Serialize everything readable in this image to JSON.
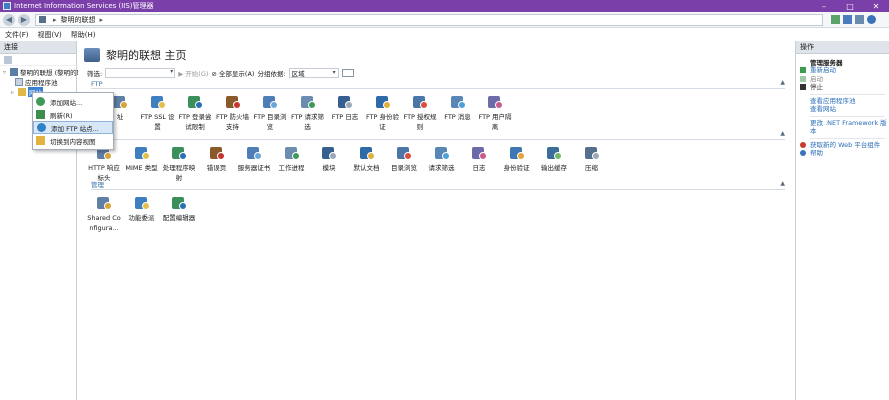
{
  "window": {
    "title": "Internet Information Services (IIS)管理器",
    "controls": {
      "minimize": "–",
      "maximize": "□",
      "close": "✕"
    }
  },
  "address": {
    "crumbs": [
      "黎明的联想"
    ],
    "separator": "▸"
  },
  "menu": [
    "文件(F)",
    "视图(V)",
    "帮助(H)"
  ],
  "connections": {
    "header": "连接",
    "tree": [
      {
        "label": "黎明的联想 (黎明的联",
        "twisty": "▿"
      },
      {
        "label": "应用程序池",
        "twisty": ""
      },
      {
        "label": "网站",
        "twisty": "▹"
      }
    ]
  },
  "context_menu": {
    "items": [
      "添加网站...",
      "刷新(R)",
      "添加 FTP 站点...",
      "切换到内容视图"
    ],
    "highlighted_index": 2
  },
  "main": {
    "title": "黎明的联想 主页",
    "filter": {
      "label": "筛选:",
      "start": "开始(G)",
      "show_all": "全部显示(A)",
      "group_label": "分组依据:",
      "group_value": "区域"
    },
    "sections": [
      {
        "name": "FTP",
        "features": [
          "FTP 授权规则的首部截断",
          "FTP SSL 设置",
          "FTP 登录尝试限制",
          "FTP 防火墙支持",
          "FTP 目录浏览",
          "FTP 请求筛选",
          "FTP 日志",
          "FTP 身份验证",
          "FTP 授权规则",
          "FTP 消息",
          "FTP 用户隔离"
        ]
      },
      {
        "name": "",
        "features": [
          "HTTP 响应标头",
          "MIME 类型",
          "处理程序映射",
          "错误页",
          "服务器证书",
          "工作进程",
          "模块",
          "默认文档",
          "目录浏览",
          "请求筛选",
          "日志",
          "身份验证",
          "输出缓存",
          "压缩"
        ]
      },
      {
        "name": "管理",
        "features": [
          "Shared Configura...",
          "功能委派",
          "配置编辑器"
        ]
      }
    ],
    "ftp_first_label_visible": "址"
  },
  "actions": {
    "header": "操作",
    "group": "管理服务器",
    "links": [
      {
        "label": "重新启动",
        "enabled": true
      },
      {
        "label": "启动",
        "enabled": false
      },
      {
        "label": "停止",
        "enabled": true
      },
      {
        "label": "查看应用程序池",
        "enabled": true
      },
      {
        "label": "查看网站",
        "enabled": true
      },
      {
        "label": "更改 .NET Framework 版本",
        "enabled": true
      },
      {
        "label": "获取新的 Web 平台组件",
        "enabled": true
      },
      {
        "label": "帮助",
        "enabled": true
      }
    ]
  },
  "colors": {
    "titlebar": "#7a3fa8",
    "link": "#2b6eb7",
    "section": "#3470a8",
    "highlight": "#d7e7f7"
  }
}
